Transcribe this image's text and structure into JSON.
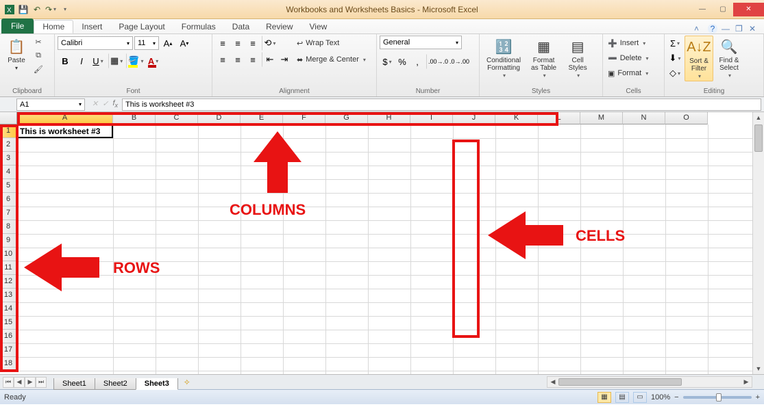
{
  "title": "Workbooks and Worksheets Basics - Microsoft Excel",
  "file_tab": "File",
  "tabs": [
    "Home",
    "Insert",
    "Page Layout",
    "Formulas",
    "Data",
    "Review",
    "View"
  ],
  "active_tab": "Home",
  "groups": {
    "clipboard": "Clipboard",
    "font": "Font",
    "alignment": "Alignment",
    "number": "Number",
    "styles": "Styles",
    "cells": "Cells",
    "editing": "Editing"
  },
  "clipboard": {
    "paste": "Paste"
  },
  "font": {
    "name": "Calibri",
    "size": "11"
  },
  "alignment": {
    "wrap": "Wrap Text",
    "merge": "Merge & Center"
  },
  "number": {
    "format": "General"
  },
  "styles": {
    "cond": "Conditional\nFormatting",
    "table": "Format\nas Table",
    "cell": "Cell\nStyles"
  },
  "cells": {
    "insert": "Insert",
    "delete": "Delete",
    "format": "Format"
  },
  "editing": {
    "sort": "Sort &\nFilter",
    "find": "Find &\nSelect"
  },
  "name_box": "A1",
  "formula": "This is worksheet #3",
  "columns": [
    "A",
    "B",
    "C",
    "D",
    "E",
    "F",
    "G",
    "H",
    "I",
    "J",
    "K",
    "L",
    "M",
    "N",
    "O"
  ],
  "rows": [
    "1",
    "2",
    "3",
    "4",
    "5",
    "6",
    "7",
    "8",
    "9",
    "10",
    "11",
    "12",
    "13",
    "14",
    "15",
    "16",
    "17",
    "18"
  ],
  "active_cell_value": "This is worksheet #3",
  "annotations": {
    "columns": "COLUMNS",
    "rows": "ROWS",
    "cells": "CELLS"
  },
  "sheets": [
    "Sheet1",
    "Sheet2",
    "Sheet3"
  ],
  "active_sheet": "Sheet3",
  "status_left": "Ready",
  "zoom": "100%"
}
